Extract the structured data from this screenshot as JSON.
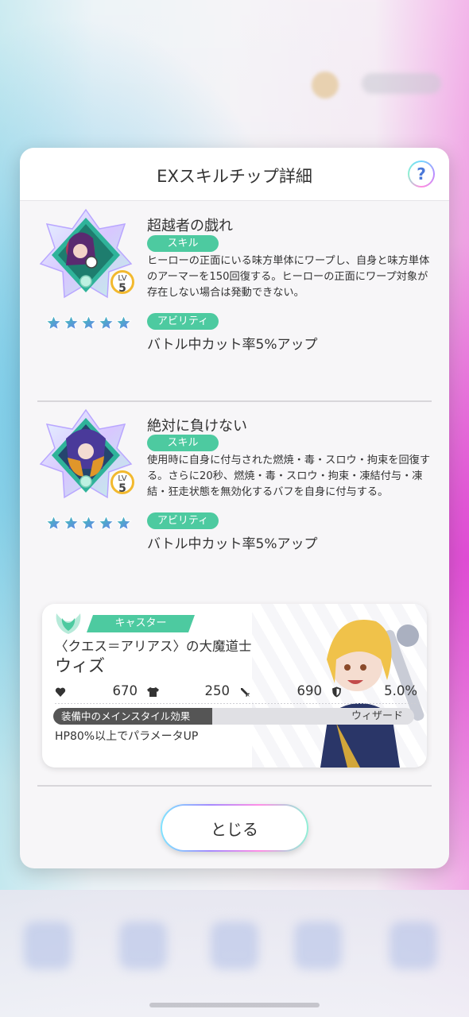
{
  "modal": {
    "title": "EXスキルチップ詳細",
    "help_label": "?",
    "close_label": "とじる"
  },
  "chips": [
    {
      "name": "超越者の戯れ",
      "level_label": "LV",
      "level": "5",
      "stars": 5,
      "skill_tag": "スキル",
      "skill_desc": "ヒーローの正面にいる味方単体にワープし、自身と味方単体のアーマーを150回復する。ヒーローの正面にワープ対象が存在しない場合は発動できない。",
      "ability_tag": "アビリティ",
      "ability_desc": "バトル中カット率5%アップ",
      "art_colors": [
        "#2fb39a",
        "#b23a5a",
        "#5a2a70"
      ]
    },
    {
      "name": "絶対に負けない",
      "level_label": "LV",
      "level": "5",
      "stars": 5,
      "skill_tag": "スキル",
      "skill_desc": "使用時に自身に付与された燃焼・毒・スロウ・拘束を回復する。さらに20秒、燃焼・毒・スロウ・拘束・凍結付与・凍結・狂走状態を無効化するバフを自身に付与する。",
      "ability_tag": "アビリティ",
      "ability_desc": "バトル中カット率5%アップ",
      "art_colors": [
        "#2fb39a",
        "#4a3a9a",
        "#e0962a"
      ]
    }
  ],
  "character": {
    "class_tag": "キャスター",
    "title": "〈クエス＝アリアス〉の大魔道士",
    "name": "ウィズ",
    "stats": {
      "hp": "670",
      "defense": "250",
      "attack": "690",
      "cut_rate": "5.0%"
    },
    "effect_label": "装備中のメインスタイル効果",
    "style_name": "ウィザード",
    "effect_desc": "HP80%以上でパラメータUP"
  },
  "colors": {
    "accent_green": "#4dcaa0",
    "star_teal": "#3cc8b0",
    "star_blue": "#6a7cf0",
    "level_ring": "#f2b92f"
  },
  "icons": {
    "help": "question-icon",
    "hp": "heart-icon",
    "defense": "shirt-icon",
    "attack": "sword-icon",
    "cut_rate": "shield-icon",
    "class": "phoenix-emblem-icon"
  }
}
